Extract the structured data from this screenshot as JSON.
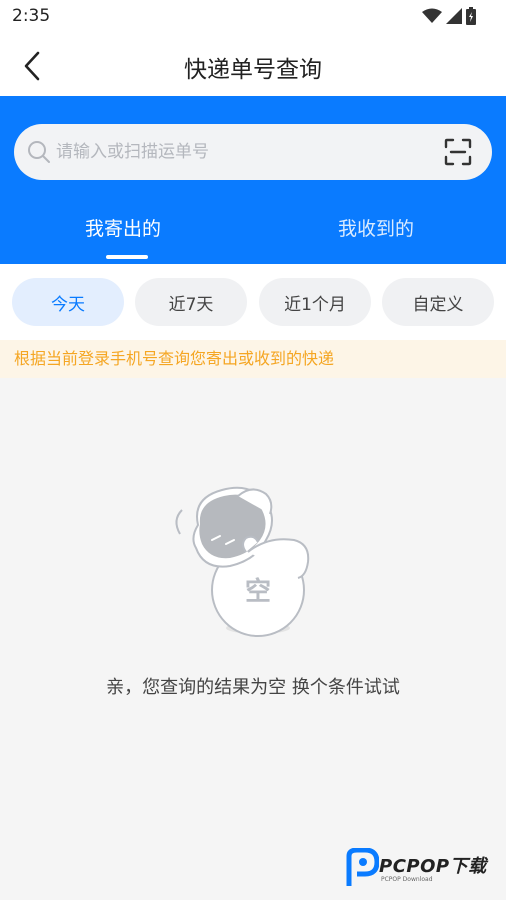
{
  "status_bar": {
    "time": "2:35",
    "icons": [
      "wifi-icon",
      "signal-icon",
      "battery-icon"
    ]
  },
  "nav": {
    "title": "快递单号查询",
    "back_icon": "chevron-left-icon"
  },
  "search": {
    "placeholder": "请输入或扫描运单号",
    "value": "",
    "search_icon": "search-icon",
    "scan_icon": "scan-icon"
  },
  "tabs": [
    {
      "label": "我寄出的",
      "active": true
    },
    {
      "label": "我收到的",
      "active": false
    }
  ],
  "filters": [
    {
      "label": "今天",
      "active": true
    },
    {
      "label": "近7天",
      "active": false
    },
    {
      "label": "近1个月",
      "active": false
    },
    {
      "label": "自定义",
      "active": false
    }
  ],
  "notice": "根据当前登录手机号查询您寄出或收到的快递",
  "empty": {
    "badge_text": "空",
    "message": "亲，您查询的结果为空 换个条件试试"
  },
  "watermark": {
    "brand": "PCPOP下载",
    "sub": "PCPOP Download"
  },
  "colors": {
    "primary": "#0a7bff",
    "notice_text": "#f5a623",
    "notice_bg": "#fdf5e7",
    "chip_active_bg": "#e3eefe"
  }
}
